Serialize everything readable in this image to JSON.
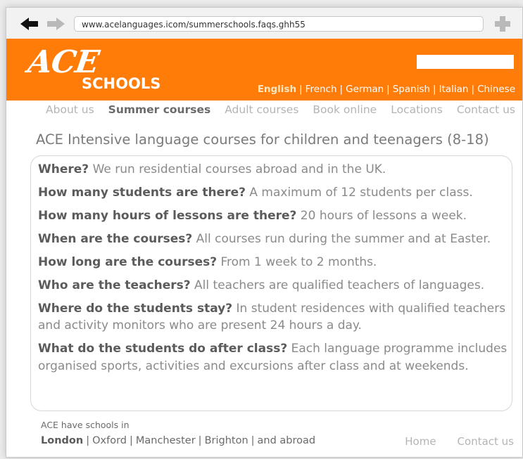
{
  "browser": {
    "url": "www.acelanguages.icom/summerschools.faqs.ghh55",
    "back_icon": "arrow-left-icon",
    "forward_icon": "arrow-right-icon",
    "add_icon": "plus-icon"
  },
  "header": {
    "logo_main": "ACE",
    "logo_sub": "SCHOOLS",
    "background_color": "#ff7c09",
    "languages": [
      "English",
      "French",
      "German",
      "Spanish",
      "Italian",
      "Chinese"
    ],
    "active_language": "English"
  },
  "nav": {
    "items": [
      "About us",
      "Summer courses",
      "Adult courses",
      "Book online",
      "Locations",
      "Contact us"
    ],
    "active": "Summer courses"
  },
  "main": {
    "title": "ACE Intensive language courses for children and teenagers (8-18)",
    "faqs": [
      {
        "q": "Where?",
        "a": "We run residential courses abroad and in the UK."
      },
      {
        "q": "How many students are there?",
        "a": "A maximum of 12 students per class."
      },
      {
        "q": "How many hours of lessons are there?",
        "a": "20 hours of lessons a week."
      },
      {
        "q": "When are the courses?",
        "a": "All courses run during the summer and at Easter."
      },
      {
        "q": "How long are the courses?",
        "a": "From 1 week to 2 months."
      },
      {
        "q": "Who are the teachers?",
        "a": "All teachers are qualified teachers of languages."
      },
      {
        "q": "Where do the students stay?",
        "a": "In student residences with qualified teachers and activity monitors who are present 24 hours a day."
      },
      {
        "q": "What do the students do after class?",
        "a": "Each language programme includes organised sports, activities and excursions after class and at weekends."
      }
    ]
  },
  "footer": {
    "label": "ACE have schools in",
    "cities": [
      "London",
      "Oxford",
      "Manchester",
      "Brighton",
      "and abroad"
    ],
    "active_city": "London",
    "home": "Home",
    "contact": "Contact us"
  }
}
